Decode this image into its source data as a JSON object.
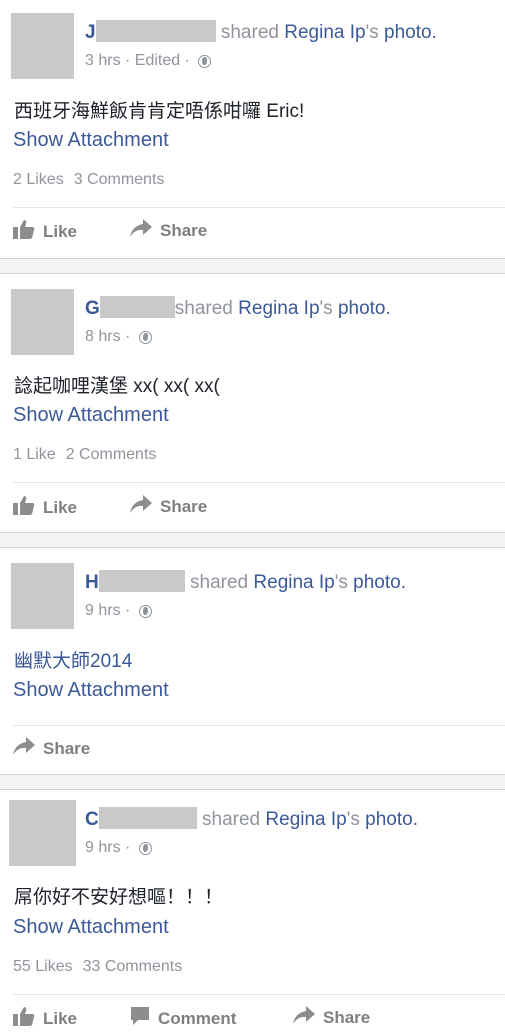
{
  "posts": [
    {
      "initial": "J",
      "shared_text": "shared",
      "owner": "Regina Ip",
      "owner_suffix": "'s",
      "object": "photo.",
      "time": "3 hrs",
      "edited": "Edited",
      "body_cjk": "西班牙海鮮飯肯肯定唔係咁囉",
      "body_latin": " Eric!",
      "attachment": "Show Attachment",
      "likes": "2 Likes",
      "comments": "3 Comments",
      "actions": [
        "Like",
        "Share"
      ]
    },
    {
      "initial": "G",
      "shared_text": "shared",
      "owner": "Regina Ip",
      "owner_suffix": "'s",
      "object": "photo.",
      "time": "8 hrs",
      "body_cjk": "諗起咖哩漢堡",
      "body_latin": " xx( xx( xx(",
      "attachment": "Show Attachment",
      "likes": "1 Like",
      "comments": "2 Comments",
      "actions": [
        "Like",
        "Share"
      ]
    },
    {
      "initial": "H",
      "shared_text": "shared",
      "owner": "Regina Ip",
      "owner_suffix": "'s",
      "object": "photo.",
      "time": "9 hrs",
      "body_cjk": "幽默大師",
      "body_latin": "2014",
      "attachment": "Show Attachment",
      "actions": [
        "Share"
      ]
    },
    {
      "initial": "C",
      "shared_text": "shared",
      "owner": "Regina Ip",
      "owner_suffix": "'s",
      "object": "photo.",
      "time": "9 hrs",
      "body_cjk": "屌你好不安好想嘔！！！",
      "attachment": "Show Attachment",
      "likes": "55 Likes",
      "comments": "33 Comments",
      "actions": [
        "Like",
        "Comment",
        "Share"
      ]
    }
  ],
  "colors": {
    "link": "#3b5998",
    "meta": "#90949c",
    "redaction": "#c9c9c9"
  },
  "icons": {
    "like": "thumbs-up-icon",
    "share": "share-arrow-icon",
    "comment": "comment-bubble-icon",
    "audience": "globe-icon"
  }
}
